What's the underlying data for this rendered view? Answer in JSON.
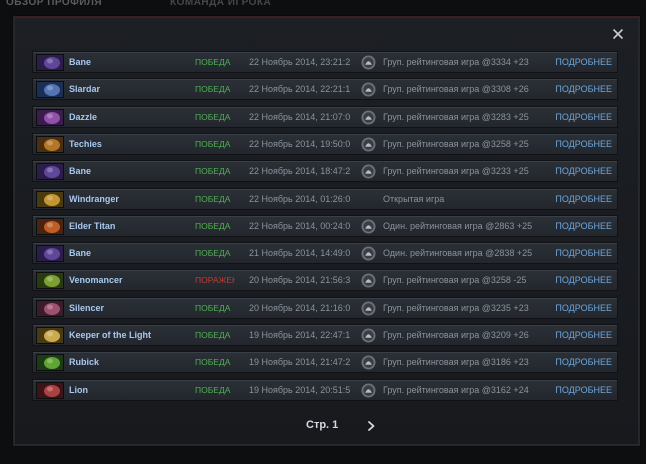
{
  "background_tabs": [
    "ОБЗОР ПРОФИЛЯ",
    "КОМАНДА ИГРОКА"
  ],
  "pagination": {
    "page_label": "Стр. 1"
  },
  "colors": {
    "win": "#4eb152",
    "loss": "#c23a33",
    "link": "#6ea6dc",
    "hero_name": "#a9c8f0"
  },
  "matches": [
    {
      "hero": "Bane",
      "result": "ПОБЕДА",
      "outcome": "win",
      "date": "22 Ноябрь 2014, 23:21:2",
      "ranked_icon": true,
      "mode": "Груп. рейтинговая игра @3334 +23",
      "details": "ПОДРОБНЕЕ",
      "icon_colors": [
        "#2a1d4a",
        "#6b4fa8"
      ]
    },
    {
      "hero": "Slardar",
      "result": "ПОБЕДА",
      "outcome": "win",
      "date": "22 Ноябрь 2014, 22:21:1",
      "ranked_icon": true,
      "mode": "Груп. рейтинговая игра @3308 +26",
      "details": "ПОДРОБНЕЕ",
      "icon_colors": [
        "#1b2f55",
        "#5d7fc4"
      ]
    },
    {
      "hero": "Dazzle",
      "result": "ПОБЕДА",
      "outcome": "win",
      "date": "22 Ноябрь 2014, 21:07:0",
      "ranked_icon": true,
      "mode": "Груп. рейтинговая игра @3283 +25",
      "details": "ПОДРОБНЕЕ",
      "icon_colors": [
        "#3a1c4a",
        "#a05bb8"
      ]
    },
    {
      "hero": "Techies",
      "result": "ПОБЕДА",
      "outcome": "win",
      "date": "22 Ноябрь 2014, 19:50:0",
      "ranked_icon": true,
      "mode": "Груп. рейтинговая игра @3258 +25",
      "details": "ПОДРОБНЕЕ",
      "icon_colors": [
        "#4a2e12",
        "#c7842d"
      ]
    },
    {
      "hero": "Bane",
      "result": "ПОБЕДА",
      "outcome": "win",
      "date": "22 Ноябрь 2014, 18:47:2",
      "ranked_icon": true,
      "mode": "Груп. рейтинговая игра @3233 +25",
      "details": "ПОДРОБНЕЕ",
      "icon_colors": [
        "#2a1d4a",
        "#6b4fa8"
      ]
    },
    {
      "hero": "Windranger",
      "result": "ПОБЕДА",
      "outcome": "win",
      "date": "22 Ноябрь 2014, 01:26:0",
      "ranked_icon": false,
      "mode": "Открытая игра",
      "details": "ПОДРОБНЕЕ",
      "icon_colors": [
        "#4a3a10",
        "#d8a63a"
      ]
    },
    {
      "hero": "Elder Titan",
      "result": "ПОБЕДА",
      "outcome": "win",
      "date": "22 Ноябрь 2014, 00:24:0",
      "ranked_icon": true,
      "mode": "Один. рейтинговая игра @2863 +25",
      "details": "ПОДРОБНЕЕ",
      "icon_colors": [
        "#4a2410",
        "#d46a2a"
      ]
    },
    {
      "hero": "Bane",
      "result": "ПОБЕДА",
      "outcome": "win",
      "date": "21 Ноябрь 2014, 14:49:0",
      "ranked_icon": true,
      "mode": "Один. рейтинговая игра @2838 +25",
      "details": "ПОДРОБНЕЕ",
      "icon_colors": [
        "#2a1d4a",
        "#6b4fa8"
      ]
    },
    {
      "hero": "Venomancer",
      "result": "ПОРАЖЕНИЕ",
      "outcome": "loss",
      "date": "20 Ноябрь 2014, 21:56:3",
      "ranked_icon": true,
      "mode": "Груп. рейтинговая игра @3258 -25",
      "details": "ПОДРОБНЕЕ",
      "icon_colors": [
        "#2a3a10",
        "#8ab23a"
      ]
    },
    {
      "hero": "Silencer",
      "result": "ПОБЕДА",
      "outcome": "win",
      "date": "20 Ноябрь 2014, 21:16:0",
      "ranked_icon": true,
      "mode": "Груп. рейтинговая игра @3235 +23",
      "details": "ПОДРОБНЕЕ",
      "icon_colors": [
        "#3a1c2a",
        "#b05a7a"
      ]
    },
    {
      "hero": "Keeper of the Light",
      "result": "ПОБЕДА",
      "outcome": "win",
      "date": "19 Ноябрь 2014, 22:47:1",
      "ranked_icon": true,
      "mode": "Груп. рейтинговая игра @3209 +26",
      "details": "ПОДРОБНЕЕ",
      "icon_colors": [
        "#4a3a14",
        "#e0c05a"
      ]
    },
    {
      "hero": "Rubick",
      "result": "ПОБЕДА",
      "outcome": "win",
      "date": "19 Ноябрь 2014, 21:47:2",
      "ranked_icon": true,
      "mode": "Груп. рейтинговая игра @3186 +23",
      "details": "ПОДРОБНЕЕ",
      "icon_colors": [
        "#1c3a14",
        "#6ab83a"
      ]
    },
    {
      "hero": "Lion",
      "result": "ПОБЕДА",
      "outcome": "win",
      "date": "19 Ноябрь 2014, 20:51:5",
      "ranked_icon": true,
      "mode": "Груп. рейтинговая игра @3162 +24",
      "details": "ПОДРОБНЕЕ",
      "icon_colors": [
        "#3a1418",
        "#c04a4a"
      ]
    }
  ]
}
